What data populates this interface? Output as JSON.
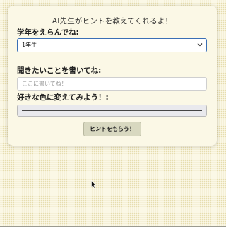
{
  "form": {
    "title": "AI先生がヒントを教えてくれるよ！",
    "grade_label": "学年をえらんでね:",
    "grade_selected": "1年生",
    "question_label": "聞きたいことを書いてね:",
    "question_placeholder": "ここに書いてね！",
    "color_label": "好きな色に変えてみよう！:",
    "submit_label": "ヒントをもらう！"
  },
  "colors": {
    "background": "#fbf8e6",
    "select_border": "#3a6fb5",
    "button_bg": "#d8d8c0"
  }
}
